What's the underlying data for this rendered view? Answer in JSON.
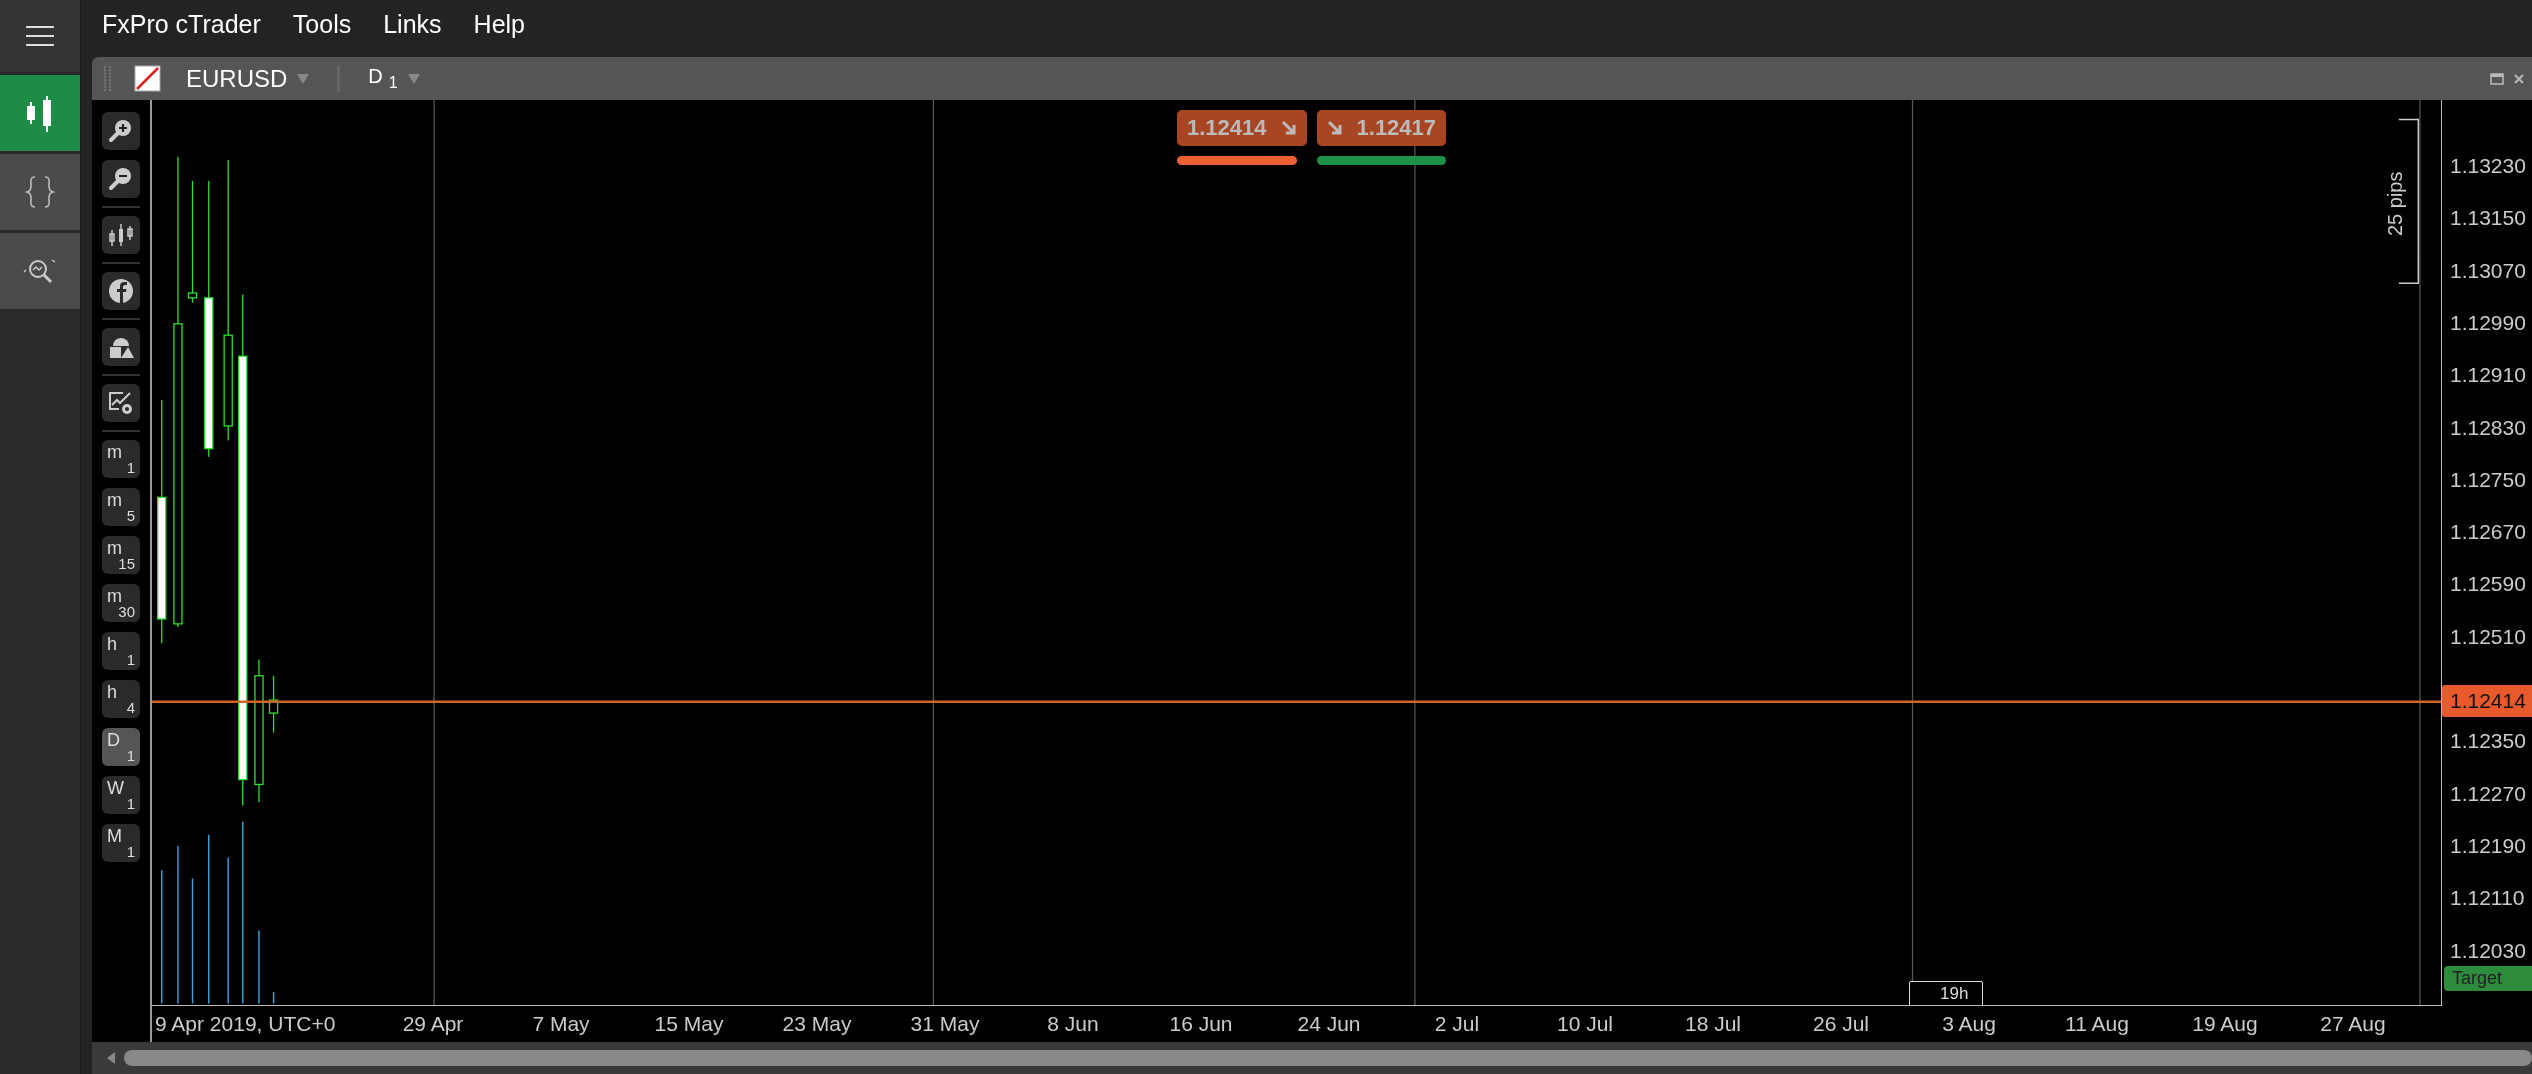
{
  "sidebar": {
    "items": [
      {
        "kind": "menu",
        "selected": false
      },
      {
        "kind": "chart",
        "selected": true
      },
      {
        "kind": "code",
        "selected": false
      },
      {
        "kind": "analysis",
        "selected": false
      }
    ]
  },
  "menu": [
    "FxPro cTrader",
    "Tools",
    "Links",
    "Help"
  ],
  "chart_header": {
    "symbol": "EURUSD",
    "timeframe": "D",
    "timeframe_sub": "1"
  },
  "quotes": {
    "bid": "1.12414",
    "ask": "1.12417"
  },
  "toolbar": {
    "tools": [
      {
        "kind": "zoom-in"
      },
      {
        "kind": "zoom-out"
      },
      {
        "kind": "candles"
      },
      {
        "kind": "social"
      },
      {
        "kind": "shapes"
      },
      {
        "kind": "settings"
      }
    ],
    "timeframes": [
      {
        "letter": "m",
        "num": "1",
        "selected": false
      },
      {
        "letter": "m",
        "num": "5",
        "selected": false
      },
      {
        "letter": "m",
        "num": "15",
        "selected": false
      },
      {
        "letter": "m",
        "num": "30",
        "selected": false
      },
      {
        "letter": "h",
        "num": "1",
        "selected": false
      },
      {
        "letter": "h",
        "num": "4",
        "selected": false
      },
      {
        "letter": "D",
        "num": "1",
        "selected": true
      },
      {
        "letter": "W",
        "num": "1",
        "selected": false
      },
      {
        "letter": "M",
        "num": "1",
        "selected": false
      }
    ]
  },
  "pips_label": "25 pips",
  "price_axis": {
    "labels": [
      "1.13230",
      "1.13150",
      "1.13070",
      "1.12990",
      "1.12910",
      "1.12830",
      "1.12750",
      "1.12670",
      "1.12590",
      "1.12510",
      "1.12350",
      "1.12270",
      "1.12190",
      "1.12110",
      "1.12030"
    ],
    "current_price": "1.12414",
    "target_label": "Target"
  },
  "time_axis": {
    "labels": [
      "9 Apr 2019, UTC+0",
      "29 Apr",
      "7 May",
      "15 May",
      "23 May",
      "31 May",
      "8 Jun",
      "16 Jun",
      "24 Jun",
      "2 Jul",
      "10 Jul",
      "18 Jul",
      "26 Jul",
      "3 Aug",
      "11 Aug",
      "19 Aug",
      "27 Aug"
    ],
    "countdown": "19h"
  }
}
